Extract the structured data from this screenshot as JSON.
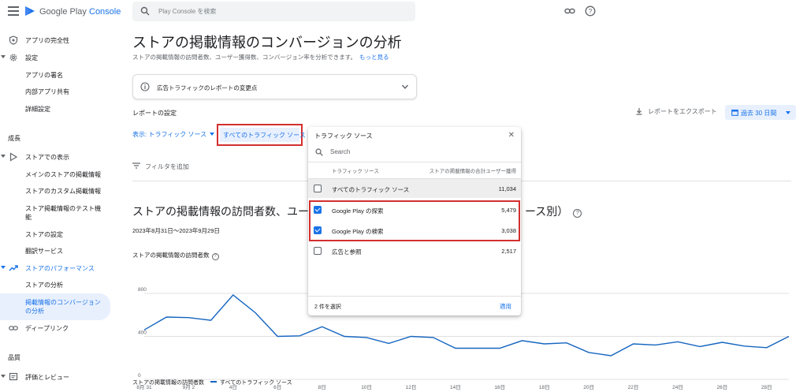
{
  "app": {
    "brand_prefix": "Google Play",
    "brand_suffix": "Console",
    "search_placeholder": "Play Console を検索"
  },
  "sidebar": {
    "items": [
      {
        "label": "アプリの完全性",
        "icon": "shield-icon"
      },
      {
        "label": "設定",
        "icon": "gear-icon"
      },
      {
        "label": "アプリの署名"
      },
      {
        "label": "内部アプリ共有"
      },
      {
        "label": "詳細設定"
      },
      {
        "label": "ストアでの表示",
        "icon": "play-icon"
      },
      {
        "label": "メインのストアの掲載情報"
      },
      {
        "label": "ストアのカスタム掲載情報"
      },
      {
        "label": "ストア掲載情報のテスト機能"
      },
      {
        "label": "ストアの設定"
      },
      {
        "label": "翻訳サービス"
      },
      {
        "label": "ストアのパフォーマンス",
        "icon": "trending-icon"
      },
      {
        "label": "ストアの分析"
      },
      {
        "label": "掲載情報のコンバージョンの分析"
      },
      {
        "label": "ディープリンク",
        "icon": "link-icon"
      },
      {
        "label": "評価とレビュー",
        "icon": "review-icon"
      }
    ],
    "sections": {
      "growth": "成長",
      "quality": "品質"
    }
  },
  "page": {
    "title": "ストアの掲載情報のコンバージョンの分析",
    "subtitle": "ストアの掲載情報の訪問者数、ユーザー獲得数、コンバージョン率を分析できます。",
    "learn_more": "もっと見る",
    "banner_text": "広告トラフィックのレポートの変更点",
    "settings_heading": "レポートの設定",
    "export_label": "レポートをエクスポート",
    "date_button": "過去 30 日間",
    "view_selector": "表示: トラフィック ソース",
    "source_button": "すべてのトラフィック ソース",
    "add_filter": "フィルタを追加",
    "chart_title_start": "ストアの掲載情報の訪問者数、ユーザ",
    "chart_title_end": "ース別）",
    "date_range": "2023年8月31日〜2023年9月29日",
    "metric_label": "ストアの掲載情報の訪問者数",
    "legend_metric": "ストアの掲載情報の訪問者数",
    "legend_series": "すべてのトラフィック ソース"
  },
  "popup": {
    "title": "トラフィック ソース",
    "search_placeholder": "Search",
    "col_source": "トラフィック ソース",
    "col_total": "ストアの掲載情報の合計ユーザー獲得",
    "rows": [
      {
        "name": "すべてのトラフィック ソース",
        "value": "11,034",
        "checked": false
      },
      {
        "name": "Google Play の探索",
        "value": "5,479",
        "checked": true
      },
      {
        "name": "Google Play の検索",
        "value": "3,038",
        "checked": true
      },
      {
        "name": "広告と参照",
        "value": "2,517",
        "checked": false
      }
    ],
    "selected_count": "2 件を選択",
    "apply_label": "適用"
  },
  "colors": {
    "accent": "#1a73e8",
    "highlight": "#d32f2f",
    "line": "#1565c0"
  },
  "chart_data": {
    "type": "line",
    "ylim": [
      0,
      800
    ],
    "y_ticks": [
      "0",
      "400",
      "800"
    ],
    "x_ticks": [
      "8月 31",
      "9月 2",
      "4日",
      "6日",
      "8日",
      "10日",
      "12日",
      "14日",
      "16日",
      "18日",
      "20日",
      "22日",
      "24日",
      "26日",
      "28日"
    ],
    "series": [
      {
        "name": "すべてのトラフィック ソース",
        "values": [
          460,
          580,
          575,
          550,
          785,
          620,
          400,
          405,
          490,
          400,
          390,
          335,
          400,
          390,
          290,
          290,
          290,
          360,
          330,
          340,
          250,
          220,
          330,
          320,
          350,
          305,
          345,
          310,
          295,
          400
        ]
      }
    ]
  }
}
